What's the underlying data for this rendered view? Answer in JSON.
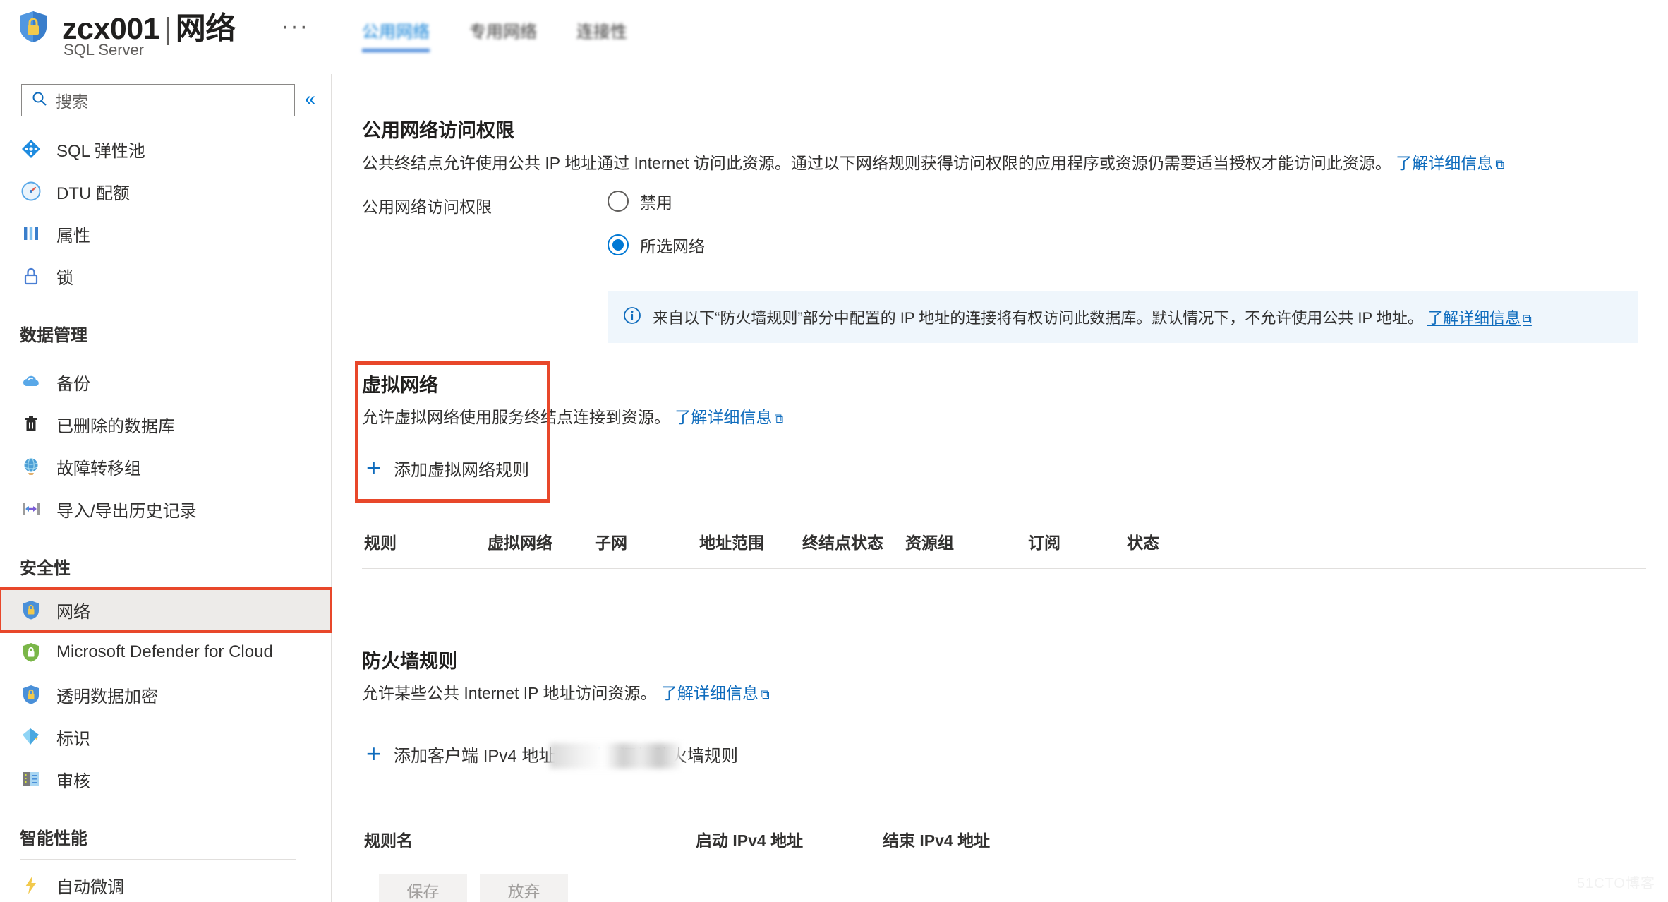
{
  "header": {
    "title_resource": "zcx001",
    "title_separator": "|",
    "title_page": "网络",
    "subtitle": "SQL Server",
    "ellipsis": "···",
    "icon": "sql-server-shield-icon"
  },
  "sidebar": {
    "search_placeholder": "搜索",
    "collapse_label": "«",
    "items": [
      {
        "label": "SQL 弹性池",
        "icon": "elastic-pool-icon",
        "selected": false
      },
      {
        "label": "DTU 配额",
        "icon": "dtu-quota-icon",
        "selected": false
      },
      {
        "label": "属性",
        "icon": "properties-icon",
        "selected": false
      },
      {
        "label": "锁",
        "icon": "lock-icon",
        "selected": false
      }
    ],
    "groups": [
      {
        "title": "数据管理",
        "items": [
          {
            "label": "备份",
            "icon": "backup-cloud-icon",
            "selected": false
          },
          {
            "label": "已删除的数据库",
            "icon": "trash-icon",
            "selected": false
          },
          {
            "label": "故障转移组",
            "icon": "globe-icon",
            "selected": false
          },
          {
            "label": "导入/导出历史记录",
            "icon": "import-export-icon",
            "selected": false
          }
        ]
      },
      {
        "title": "安全性",
        "items": [
          {
            "label": "网络",
            "icon": "network-shield-icon",
            "selected": true,
            "annotated": true
          },
          {
            "label": "Microsoft Defender for Cloud",
            "icon": "defender-shield-icon",
            "selected": false
          },
          {
            "label": "透明数据加密",
            "icon": "encryption-shield-icon",
            "selected": false
          },
          {
            "label": "标识",
            "icon": "identity-icon",
            "selected": false
          },
          {
            "label": "审核",
            "icon": "audit-icon",
            "selected": false
          }
        ]
      },
      {
        "title": "智能性能",
        "items": [
          {
            "label": "自动微调",
            "icon": "lightning-icon",
            "selected": false
          }
        ]
      }
    ]
  },
  "main": {
    "tabs": [
      {
        "label": "公用网络",
        "active": true
      },
      {
        "label": "专用网络",
        "active": false
      },
      {
        "label": "连接性",
        "active": false
      }
    ],
    "public_access": {
      "title": "公用网络访问权限",
      "description": "公共终结点允许使用公共 IP 地址通过 Internet 访问此资源。通过以下网络规则获得访问权限的应用程序或资源仍需要适当授权才能访问此资源。",
      "learn_more": "了解详细信息",
      "field_label": "公用网络访问权限",
      "options": [
        {
          "label": "禁用",
          "selected": false
        },
        {
          "label": "所选网络",
          "selected": true
        }
      ],
      "info_banner": {
        "icon": "info-circle-icon",
        "text": "来自以下“防火墙规则”部分中配置的 IP 地址的连接将有权访问此数据库。默认情况下，不允许使用公共 IP 地址。",
        "learn_more": "了解详细信息"
      }
    },
    "virtual_network": {
      "title": "虚拟网络",
      "description": "允许虚拟网络使用服务终结点连接到资源。",
      "learn_more": "了解详细信息",
      "add_rule_label": "添加虚拟网络规则",
      "table_headers": [
        "规则",
        "虚拟网络",
        "子网",
        "地址范围",
        "终结点状态",
        "资源组",
        "订阅",
        "状态"
      ]
    },
    "firewall": {
      "title": "防火墙规则",
      "description": "允许某些公共 Internet IP 地址访问资源。",
      "learn_more": "了解详细信息",
      "add_client_ip_label": "添加客户端 IPv4 地址",
      "client_ip_value": "",
      "add_firewall_rule_label": "添加防火墙规则",
      "table_headers": [
        "规则名",
        "启动 IPv4 地址",
        "结束 IPv4 地址"
      ]
    },
    "footer_buttons": [
      {
        "label": "保存",
        "enabled": false
      },
      {
        "label": "放弃",
        "enabled": false
      }
    ]
  },
  "colors": {
    "accent": "#0078d4",
    "link": "#0f6cbd",
    "annotation": "#e8472a",
    "info_bg": "#eff6fc",
    "selected_bg": "#edebe9"
  },
  "watermark": "51CTO博客"
}
